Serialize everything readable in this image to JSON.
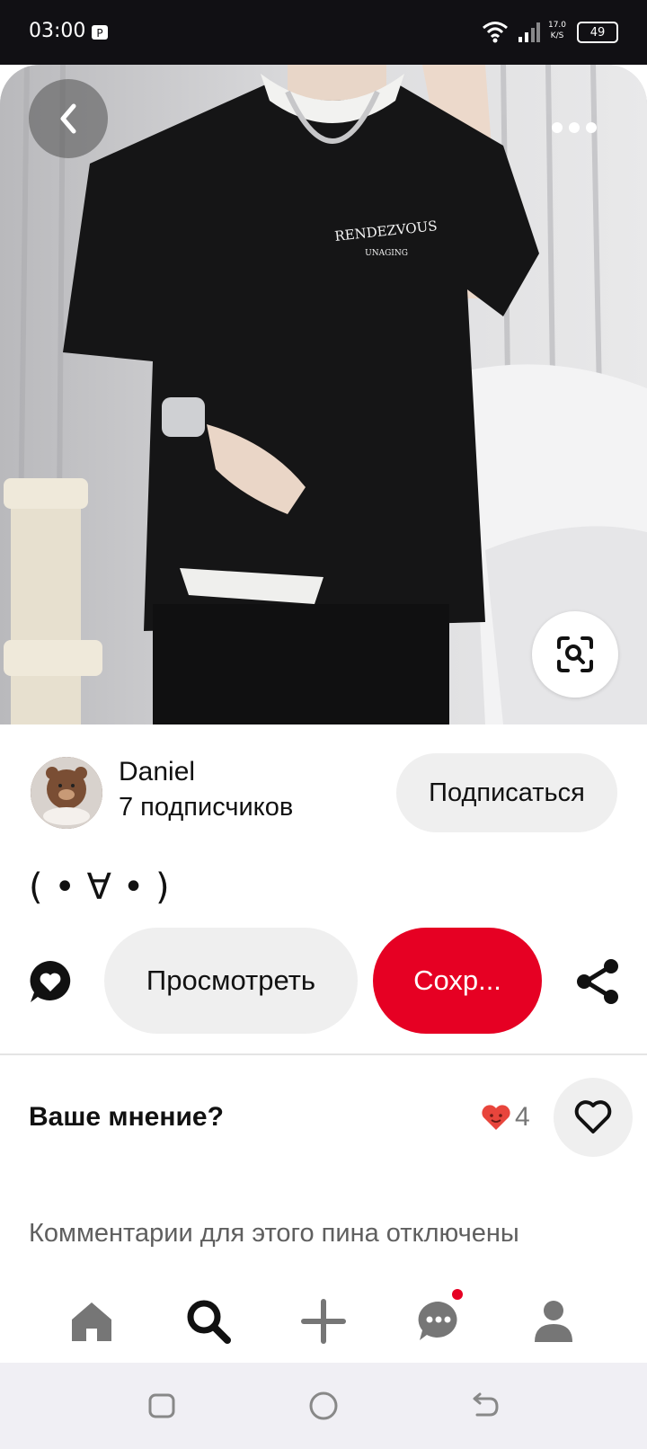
{
  "status_bar": {
    "time": "03:00",
    "network_speed": "17.0 K/S",
    "battery": "49"
  },
  "pin": {
    "title": "( • ∀ • )",
    "image_print_text": "RENDEZVOUS",
    "image_print_subtext": "UNAGING"
  },
  "creator": {
    "name": "Daniel",
    "followers": "7 подписчиков",
    "follow_label": "Подписаться"
  },
  "actions": {
    "view_label": "Просмотреть",
    "save_label": "Сохр...",
    "save_color": "#e60023"
  },
  "reactions": {
    "prompt": "Ваше мнение?",
    "count": "4",
    "heart_color": "#e8453c"
  },
  "comments": {
    "disabled_text": "Комментарии для этого пина отключены"
  },
  "bottom_nav": {
    "items": [
      {
        "icon": "home-icon"
      },
      {
        "icon": "search-icon",
        "active": true
      },
      {
        "icon": "plus-icon"
      },
      {
        "icon": "chat-icon",
        "has_notification": true
      },
      {
        "icon": "profile-icon"
      }
    ]
  },
  "system_nav": {
    "items": [
      {
        "icon": "recents-icon"
      },
      {
        "icon": "home-circle-icon"
      },
      {
        "icon": "back-arrow-icon"
      }
    ]
  }
}
